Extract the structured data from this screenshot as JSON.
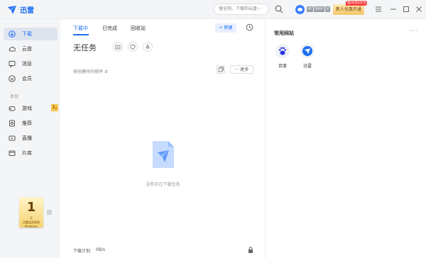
{
  "app": {
    "brand": "迅雷"
  },
  "titlebar": {
    "search_placeholder": "搜全网、下载和云盘~",
    "badges": [
      "IP",
      "SVIP",
      "V"
    ],
    "vip_button": "新人优惠开通",
    "vip_tag": "首月仅10元"
  },
  "sidebar": {
    "items": [
      {
        "label": "下载",
        "icon": "download-icon"
      },
      {
        "label": "云盘",
        "icon": "cloud-icon"
      },
      {
        "label": "消息",
        "icon": "message-icon"
      },
      {
        "label": "会员",
        "icon": "vip-icon"
      }
    ],
    "discover_label": "发现",
    "discover_items": [
      {
        "label": "游戏",
        "icon": "gamepad-icon",
        "badge": "1."
      },
      {
        "label": "推荐",
        "icon": "recommend-icon"
      },
      {
        "label": "直播",
        "icon": "live-icon"
      },
      {
        "label": "片库",
        "icon": "film-icon"
      }
    ],
    "promo": {
      "big": "1",
      "unit": "天",
      "line1": "迅雷会员体验",
      "line2": "Premium"
    }
  },
  "main": {
    "tabs": [
      "下载中",
      "已完成",
      "回收站"
    ],
    "new_button": "+ 新建",
    "no_task": "无任务",
    "sort_label": "按创建时间排序 ⇵",
    "more_button": "··· 更多",
    "empty_text": "没有正在下载任务",
    "speed_label": "下载计划",
    "speed_value": "0B/s"
  },
  "right": {
    "title": "常用网站",
    "sites": [
      {
        "name": "百度",
        "icon": "baidu-paw-icon",
        "color": "#2932e1"
      },
      {
        "name": "迅雷",
        "icon": "xunlei-bird-icon",
        "color": "#1e6ff4"
      }
    ]
  },
  "colors": {
    "accent": "#1e6ff4",
    "sidebar_bg": "#f4f5f7",
    "vip_gold": "#f5c76a",
    "vip_tag_red": "#f43f3f"
  }
}
